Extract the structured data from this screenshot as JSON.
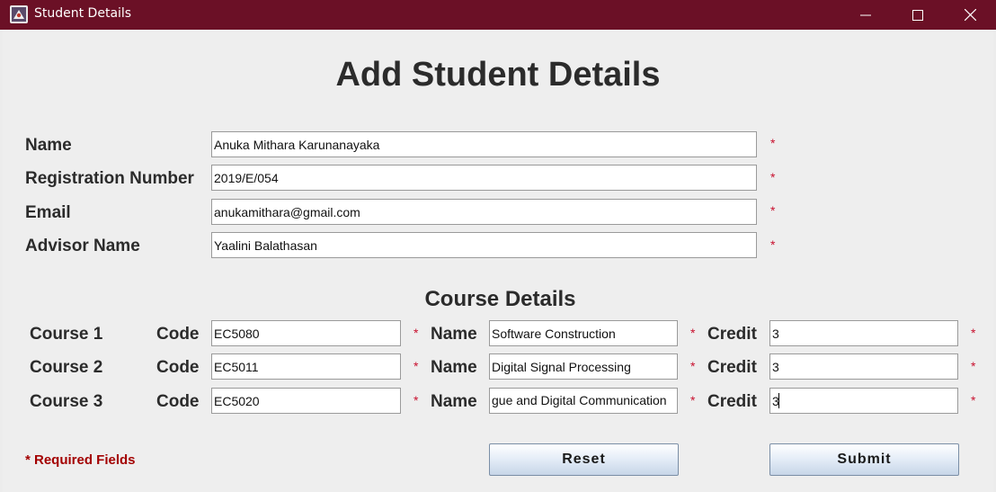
{
  "window": {
    "title": "Student Details"
  },
  "heading": "Add Student Details",
  "student": {
    "name_label": "Name",
    "name_value": "Anuka Mithara Karunanayaka",
    "reg_label": "Registration Number",
    "reg_value": "2019/E/054",
    "email_label": "Email",
    "email_value": "anukamithara@gmail.com",
    "advisor_label": "Advisor Name",
    "advisor_value": "Yaalini Balathasan"
  },
  "course_heading": "Course Details",
  "courses": [
    {
      "label": "Course 1",
      "code_label": "Code",
      "code": "EC5080",
      "name_label": "Name",
      "name": "Software Construction",
      "credit_label": "Credit",
      "credit": "3"
    },
    {
      "label": "Course 2",
      "code_label": "Code",
      "code": "EC5011",
      "name_label": "Name",
      "name": "Digital Signal Processing",
      "credit_label": "Credit",
      "credit": "3"
    },
    {
      "label": "Course 3",
      "code_label": "Code",
      "code": "EC5020",
      "name_label": "Name",
      "name": "gue and Digital Communication",
      "credit_label": "Credit",
      "credit": "3"
    }
  ],
  "required_marker": "*",
  "required_note": "* Required Fields",
  "buttons": {
    "reset": "Reset",
    "submit": "Submit"
  },
  "icons": {
    "app": "java-app-icon",
    "minimize": "minimize-icon",
    "maximize": "maximize-icon",
    "close": "close-icon"
  },
  "colors": {
    "titlebar": "#6b1026",
    "required": "#c8102e",
    "required_note": "#a30000"
  }
}
